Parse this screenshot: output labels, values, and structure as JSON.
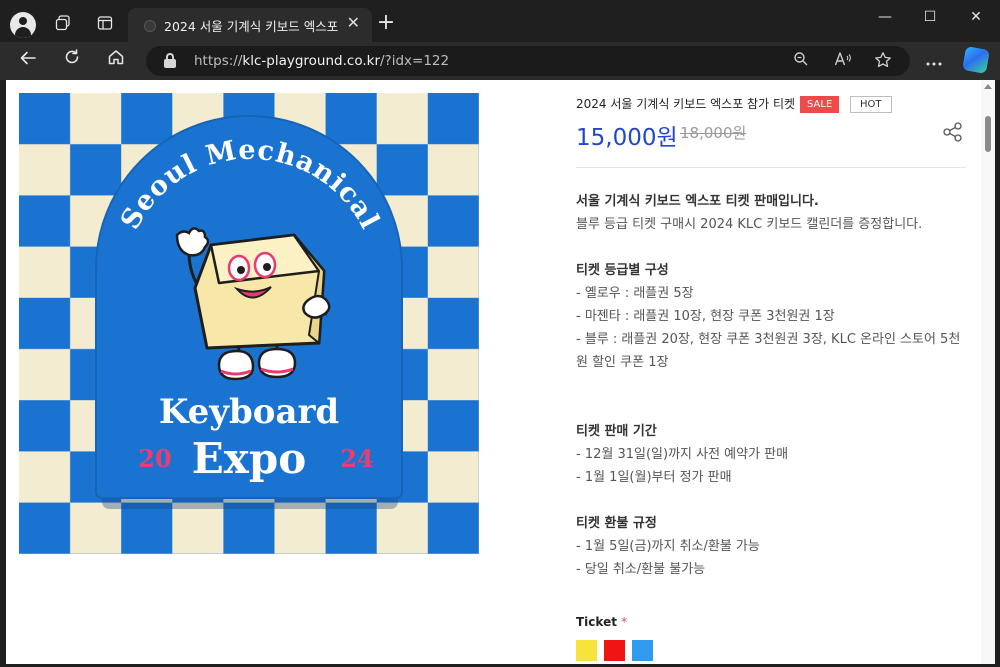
{
  "browser": {
    "tab_title": "2024 서울 기계식 키보드 엑스포",
    "url_prefix": "https://",
    "url_host": "klc-playground.co.kr",
    "url_path": "/?idx=122",
    "new_tab_glyph": "+",
    "close_glyph": "✕",
    "minimize_glyph": "—",
    "maximize_glyph": "☐"
  },
  "product": {
    "title": "2024 서울 기계식 키보드 엑스포 참가 티켓",
    "badge_sale": "SALE",
    "badge_hot": "HOT",
    "price": "15,000원",
    "original_price": "18,000원"
  },
  "description": {
    "intro_bold": "서울 기계식 키보드 엑스포 티켓 판매입니다.",
    "intro_line": "블루 등급 티켓 구매시 2024 KLC 키보드 캘린더를 증정합니다.",
    "grade_heading": "티켓 등급별 구성",
    "grade_items": [
      "- 옐로우 : 래플권 5장",
      "- 마젠타 : 래플권 10장, 현장 쿠폰 3천원권 1장",
      "- 블루 : 래플권 20장, 현장 쿠폰 3천원권 3장, KLC 온라인 스토어 5천원 할인 쿠폰 1장"
    ],
    "period_heading": "티켓 판매 기간",
    "period_items": [
      "- 12월 31일(일)까지 사전 예약가 판매",
      "- 1월 1일(월)부터 정가 판매"
    ],
    "refund_heading": "티켓 환불 규정",
    "refund_items": [
      "- 1월 5일(금)까지 취소/환불 가능",
      "- 당일 취소/환불 불가능"
    ]
  },
  "options": {
    "label": "Ticket",
    "required_mark": "*",
    "swatches": [
      {
        "name": "yellow",
        "color": "#f7e33a"
      },
      {
        "name": "magenta",
        "color": "#f01515"
      },
      {
        "name": "blue",
        "color": "#2f9af0"
      }
    ]
  },
  "poster": {
    "arc_text": "Seoul Mechanical",
    "line1": "Keyboard",
    "line2": "Expo",
    "year_left": "20",
    "year_right": "24",
    "colors": {
      "blue": "#1b73d1",
      "cream": "#f3ecd1",
      "pink": "#ea3d73",
      "key": "#f7e7a8"
    }
  }
}
